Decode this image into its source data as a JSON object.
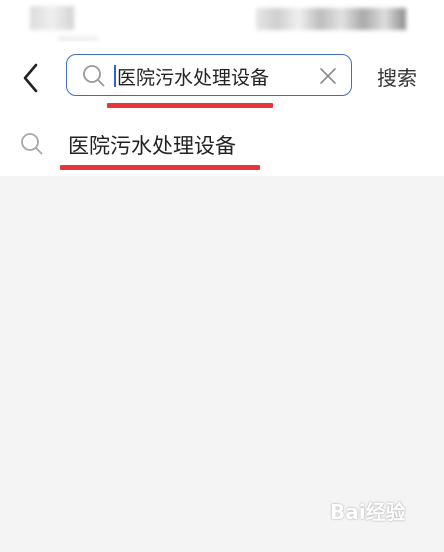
{
  "search": {
    "value": "医院污水处理设备",
    "submit_label": "搜索"
  },
  "suggestions": [
    {
      "text": "医院污水处理设备"
    }
  ],
  "watermark": {
    "text": "Bai经验"
  },
  "colors": {
    "search_border": "#3f6fb5",
    "annotation_red": "#e8353a",
    "caret": "#2a63d6",
    "background": "#f4f4f4"
  },
  "icons": {
    "back": "chevron-left-icon",
    "search": "search-icon",
    "clear": "close-icon"
  }
}
